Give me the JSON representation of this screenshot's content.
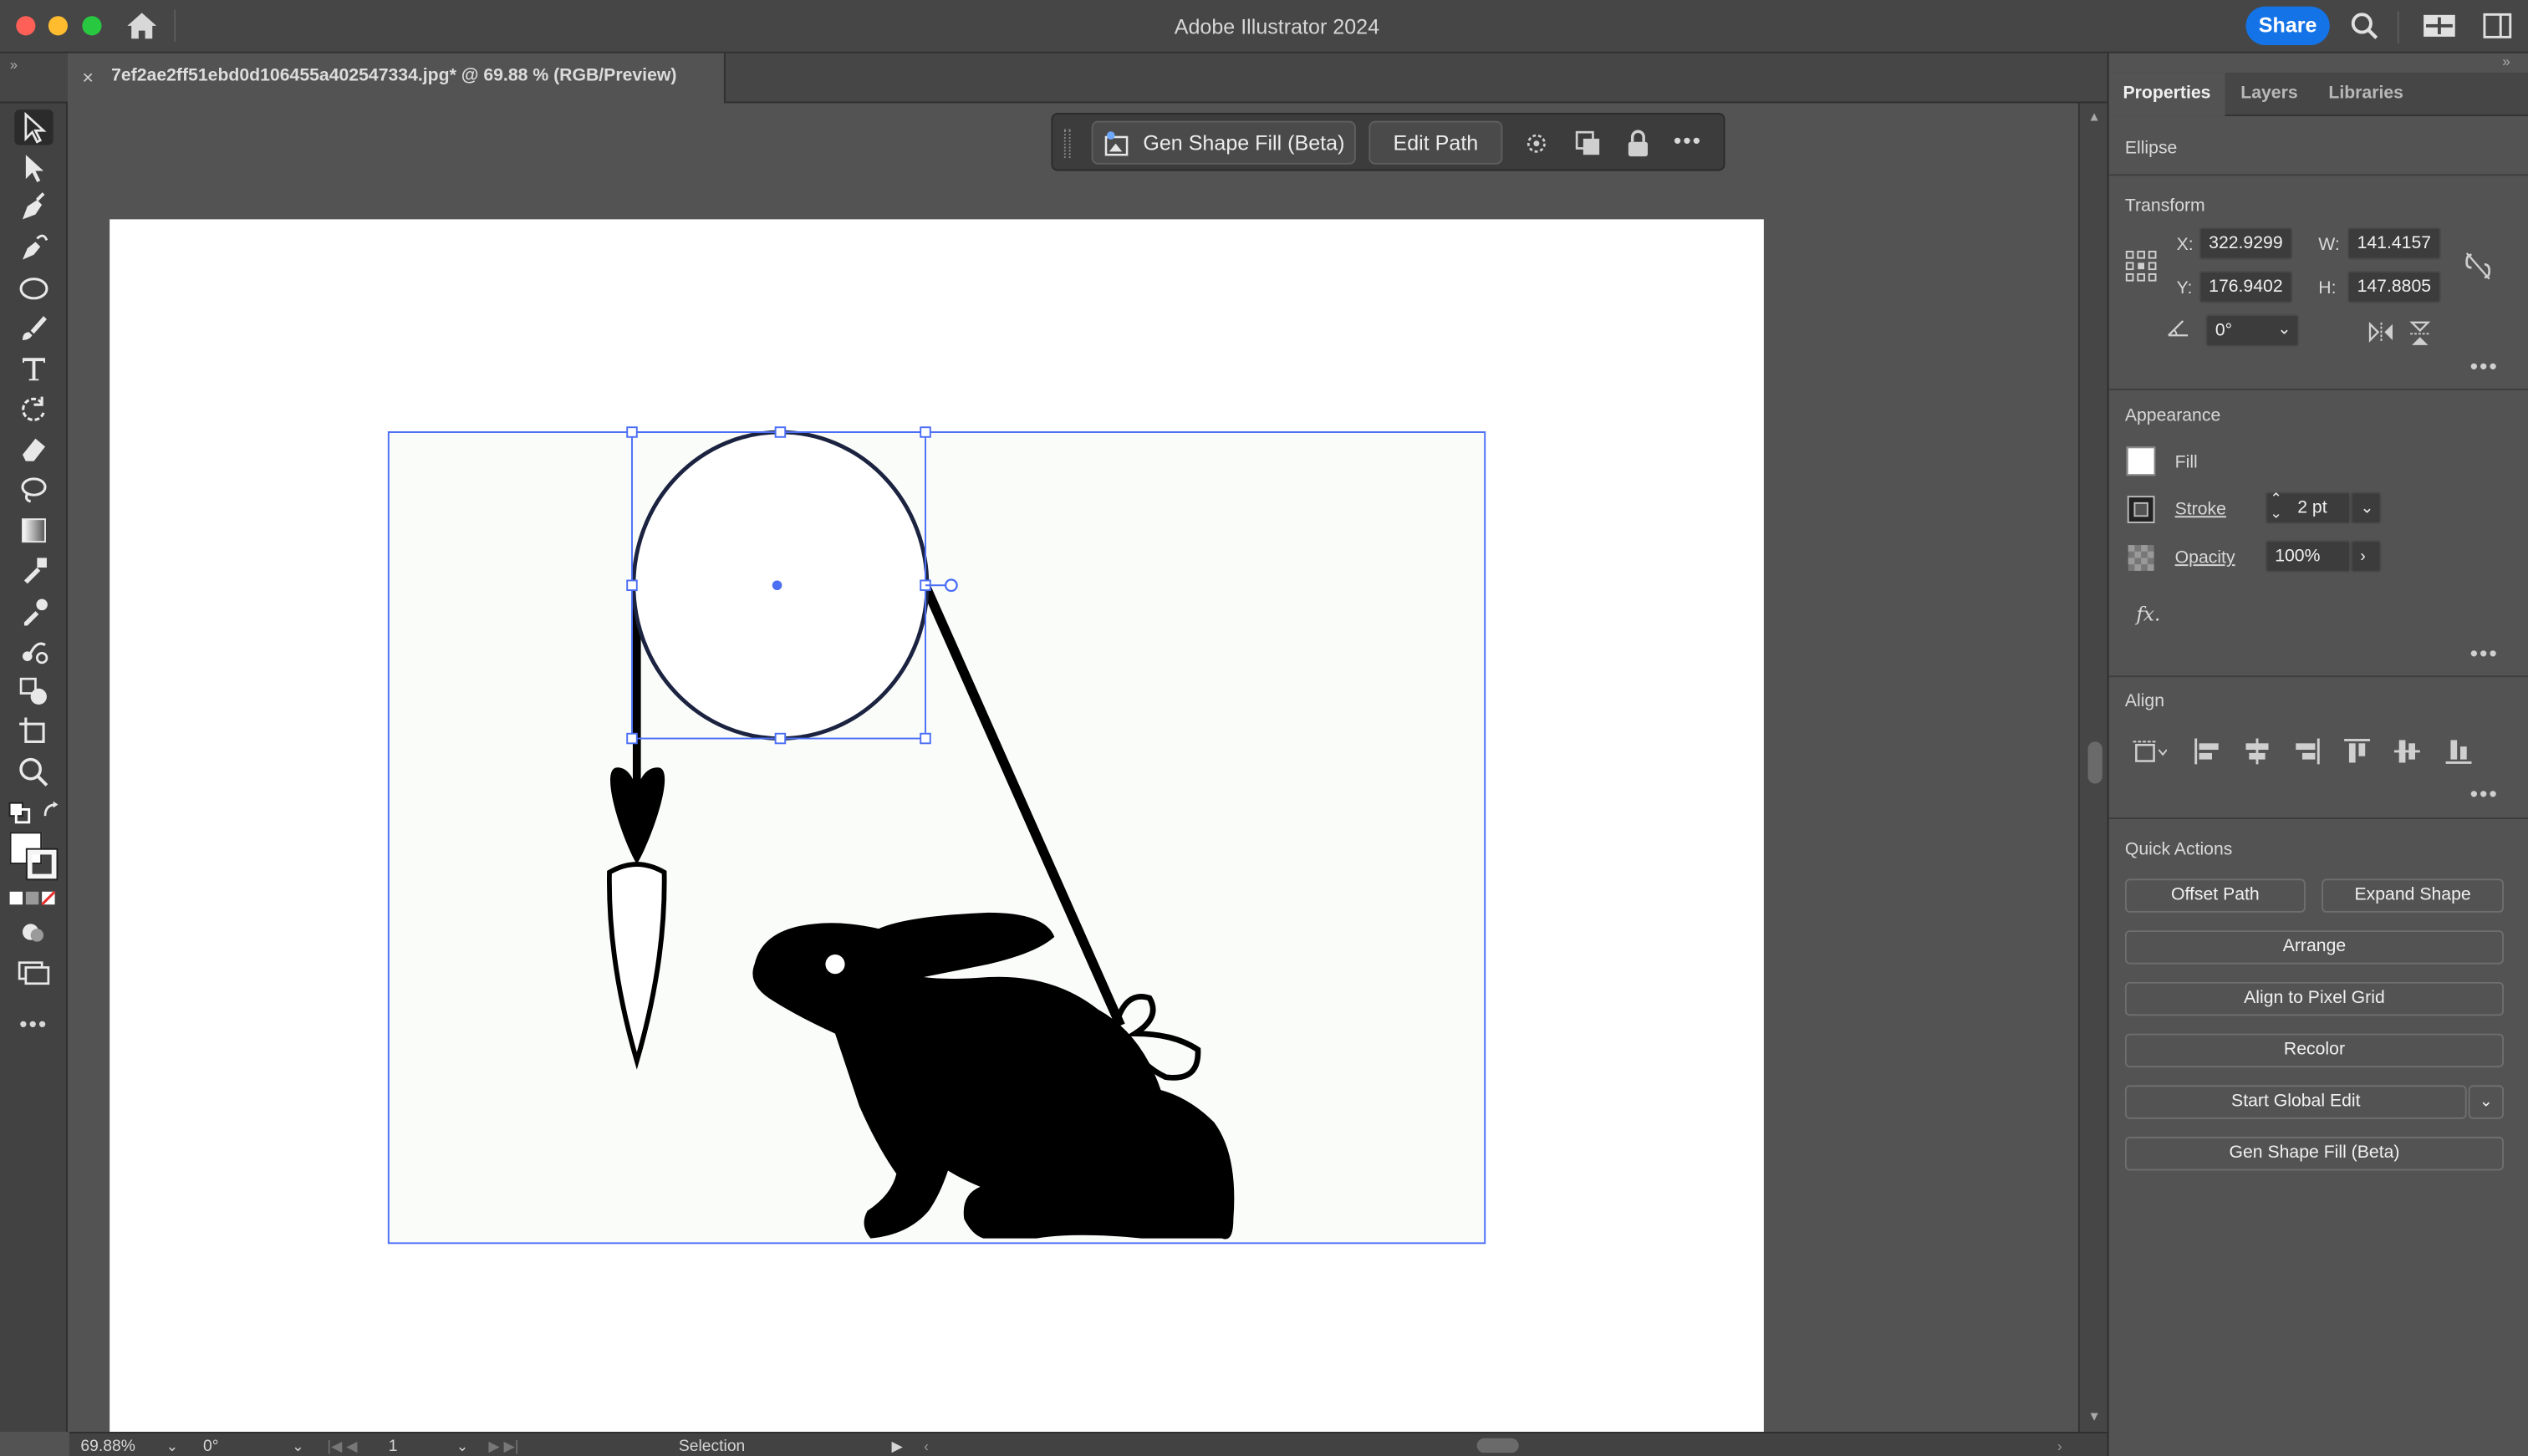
{
  "window": {
    "app_title": "Adobe Illustrator 2024",
    "share_label": "Share"
  },
  "document_tab": {
    "close": "×",
    "title": "7ef2ae2ff51ebd0d106455a402547334.jpg* @ 69.88 % (RGB/Preview)"
  },
  "context_bar": {
    "gen_shape_fill": "Gen Shape Fill (Beta)",
    "edit_path": "Edit Path"
  },
  "panel": {
    "tabs": [
      "Properties",
      "Layers",
      "Libraries"
    ],
    "object_type": "Ellipse",
    "transform": {
      "title": "Transform",
      "x_label": "X:",
      "x": "322.9299",
      "y_label": "Y:",
      "y": "176.9402",
      "w_label": "W:",
      "w": "141.4157",
      "h_label": "H:",
      "h": "147.8805",
      "rotation": "0°"
    },
    "appearance": {
      "title": "Appearance",
      "fill_label": "Fill",
      "stroke_label": "Stroke",
      "stroke_value": "2 pt",
      "opacity_label": "Opacity",
      "opacity_value": "100%",
      "fx_label": "fx."
    },
    "align": {
      "title": "Align"
    },
    "quick_actions": {
      "title": "Quick Actions",
      "offset_path": "Offset Path",
      "expand_shape": "Expand Shape",
      "arrange": "Arrange",
      "align_pixel_grid": "Align to Pixel Grid",
      "recolor": "Recolor",
      "start_global_edit": "Start Global Edit",
      "gen_shape_fill": "Gen Shape Fill (Beta)"
    }
  },
  "statusbar": {
    "zoom": "69.88%",
    "rotation": "0°",
    "artboard": "1",
    "tool": "Selection"
  },
  "colors": {
    "accent": "#1473e6",
    "selection": "#4b6ef5",
    "ui_bg": "#535353"
  }
}
